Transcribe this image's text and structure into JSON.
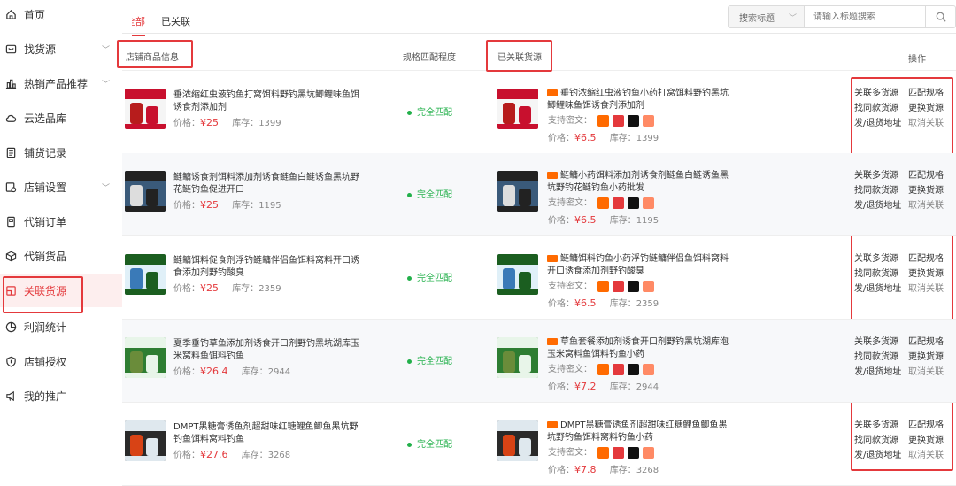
{
  "sidebar": {
    "items": [
      {
        "label": "首页"
      },
      {
        "label": "找货源"
      },
      {
        "label": "热销产品推荐"
      },
      {
        "label": "云选品库"
      },
      {
        "label": "铺货记录"
      },
      {
        "label": "店铺设置"
      },
      {
        "label": "代销订单"
      },
      {
        "label": "代销货品"
      },
      {
        "label": "关联货源",
        "active": true
      },
      {
        "label": "利润统计"
      },
      {
        "label": "店铺授权"
      },
      {
        "label": "我的推广"
      }
    ]
  },
  "tabs": [
    {
      "label": "全部"
    },
    {
      "label": "已关联"
    }
  ],
  "search": {
    "type": "搜索标题",
    "placeholder": "请输入标题搜索"
  },
  "columns": {
    "shop": "店铺商品信息",
    "match": "规格匹配程度",
    "source": "已关联货源",
    "ops": "操作"
  },
  "labels": {
    "price": "价格：",
    "stock": "库存：",
    "support": "支持密文："
  },
  "ops": {
    "link_more": "关联多货源",
    "match_spec": "匹配规格",
    "find_same": "找同款货源",
    "change_source": "更换货源",
    "ship_addr": "发/退货地址",
    "unlink": "取消关联"
  },
  "rows": [
    {
      "shop_title": "垂浓缩红虫液钓鱼打窝饵料野钓黑坑鲫鲤味鱼饵诱食剂添加剂",
      "shop_price": "¥25",
      "shop_stock": "1399",
      "match": "完全匹配",
      "src_title": "垂钓浓缩红虫液钓鱼小药打窝饵料野钓黑坑鲫鲤味鱼饵诱食剂添加剂",
      "src_price": "¥6.5",
      "src_stock": "1399"
    },
    {
      "shop_title": "鲢鳙诱食剂饵料添加剂诱食鲢鱼白鲢诱鱼黑坑野花鲢钓鱼促进开口",
      "shop_price": "¥25",
      "shop_stock": "1195",
      "match": "完全匹配",
      "src_title": "鲢鳙小药饵料添加剂诱食剂鲢鱼白鲢诱鱼黑坑野钓花鲢钓鱼小药批发",
      "src_price": "¥6.5",
      "src_stock": "1195"
    },
    {
      "shop_title": "鲢鳙饵料促食剂浮钓鲢鳙伴侣鱼饵料窝料开口诱食添加剂野钓酸臭",
      "shop_price": "¥25",
      "shop_stock": "2359",
      "match": "完全匹配",
      "src_title": "鲢鳙饵料钓鱼小药浮钓鲢鳙伴侣鱼饵料窝料开口诱食添加剂野钓酸臭",
      "src_price": "¥6.5",
      "src_stock": "2359"
    },
    {
      "shop_title": "夏季垂钓草鱼添加剂诱食开口剂野钓黑坑湖库玉米窝料鱼饵料钓鱼",
      "shop_price": "¥26.4",
      "shop_stock": "2944",
      "match": "完全匹配",
      "src_title": "草鱼套餐添加剂诱食开口剂野钓黑坑湖库泡玉米窝料鱼饵料钓鱼小药",
      "src_price": "¥7.2",
      "src_stock": "2944"
    },
    {
      "shop_title": "DMPT黑糖膏诱鱼剂超甜味红糖鲤鱼鲫鱼黑坑野钓鱼饵料窝料钓鱼",
      "shop_price": "¥27.6",
      "shop_stock": "3268",
      "match": "完全匹配",
      "src_title": "DMPT黑糖膏诱鱼剂超甜味红糖鲤鱼鲫鱼黑坑野钓鱼饵料窝料钓鱼小药",
      "src_price": "¥7.8",
      "src_stock": "3268"
    }
  ],
  "colors": {
    "accent": "#e4393c",
    "match": "#22b04a"
  }
}
